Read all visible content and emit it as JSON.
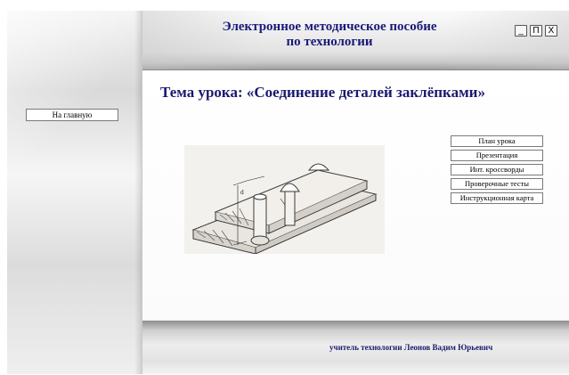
{
  "header": {
    "title_line1": "Электронное методическое пособие",
    "title_line2": "по технологии"
  },
  "window_controls": {
    "minimize": "_",
    "maximize": "П",
    "close": "X"
  },
  "lesson": {
    "title": "Тема урока: «Соединение деталей заклёпками»"
  },
  "sidebar": {
    "home_label": "На главную"
  },
  "menu": {
    "items": [
      {
        "label": "План урока"
      },
      {
        "label": "Презентация"
      },
      {
        "label": "Инт. кроссворды"
      },
      {
        "label": "Проверочные тесты"
      },
      {
        "label": "Инструкционная карта"
      }
    ]
  },
  "illustration": {
    "icon": "rivet-joint-drawing"
  },
  "footer": {
    "author": "учитель технологии Леонов Вадим Юрьевич"
  },
  "colors": {
    "title": "#1a1a7a",
    "panel": "#e8e8e8"
  }
}
